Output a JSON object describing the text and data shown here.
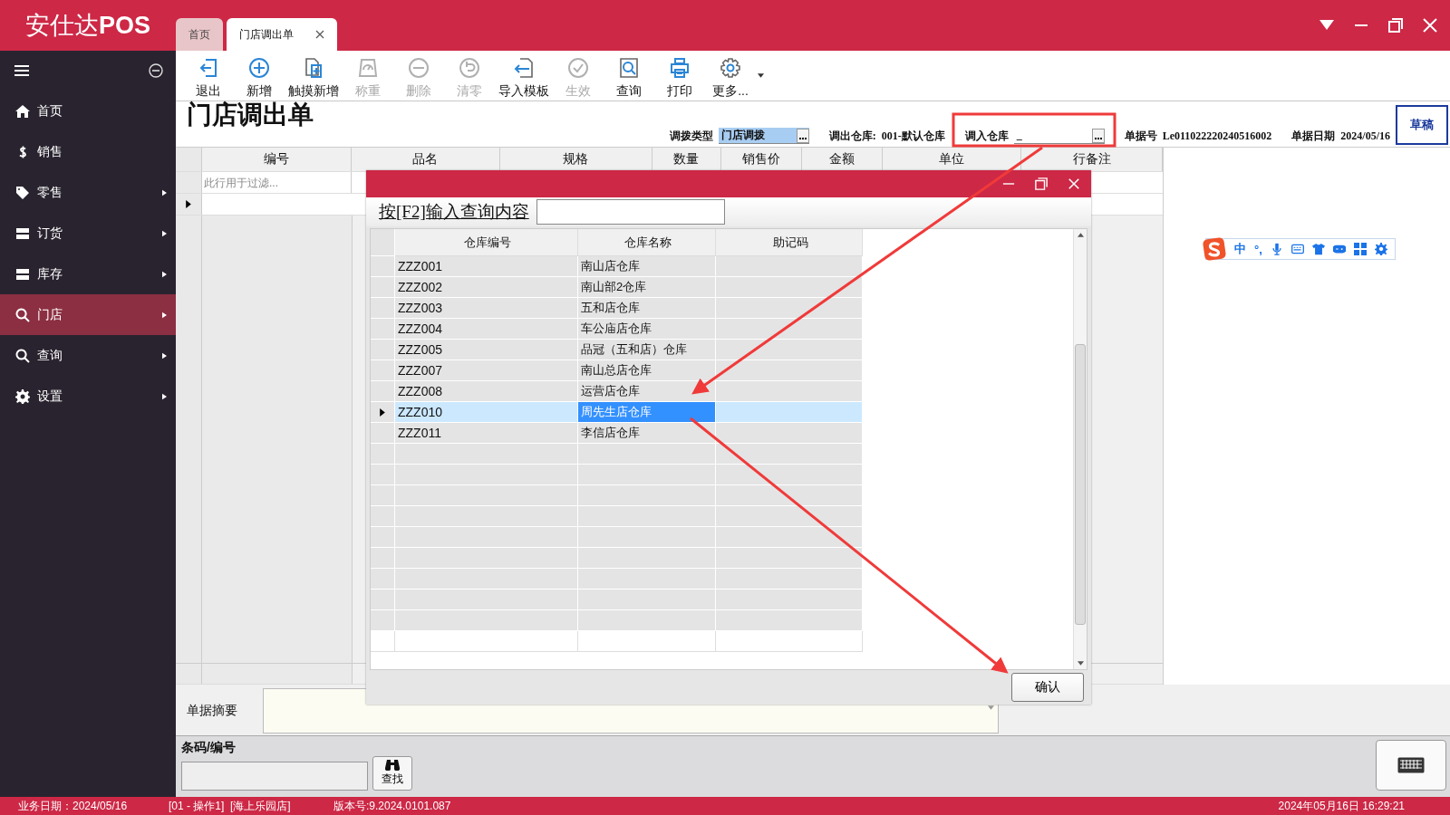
{
  "logo": "安仕达**POS**",
  "tabs": [
    {
      "label": "首页",
      "selected": false,
      "closable": false
    },
    {
      "label": "门店调出单",
      "selected": true,
      "closable": true
    }
  ],
  "sidebar": {
    "items": [
      {
        "label": "首页",
        "submenu": false,
        "selected": false
      },
      {
        "label": "销售",
        "submenu": false,
        "selected": false
      },
      {
        "label": "零售",
        "submenu": true,
        "selected": false
      },
      {
        "label": "订货",
        "submenu": true,
        "selected": false
      },
      {
        "label": "库存",
        "submenu": true,
        "selected": false
      },
      {
        "label": "门店",
        "submenu": true,
        "selected": true
      },
      {
        "label": "查询",
        "submenu": true,
        "selected": false
      },
      {
        "label": "设置",
        "submenu": true,
        "selected": false
      }
    ]
  },
  "toolbar": [
    {
      "label": "退出",
      "disabled": false
    },
    {
      "label": "新增",
      "disabled": false
    },
    {
      "label": "触摸新增",
      "disabled": false
    },
    {
      "label": "称重",
      "disabled": true
    },
    {
      "label": "删除",
      "disabled": true
    },
    {
      "label": "清零",
      "disabled": true
    },
    {
      "label": "导入模板",
      "disabled": false
    },
    {
      "label": "生效",
      "disabled": true
    },
    {
      "label": "查询",
      "disabled": false
    },
    {
      "label": "打印",
      "disabled": false
    },
    {
      "label": "更多...",
      "disabled": false
    }
  ],
  "page_title": "门店调出单",
  "fields": [
    {
      "label": "调拨类型",
      "value": "门店调拨",
      "kind": "picker"
    },
    {
      "label": "调出仓库:",
      "value": "001-默认仓库",
      "kind": "text"
    },
    {
      "label": "调入仓库",
      "value": "_",
      "kind": "picker"
    },
    {
      "label": "单据号",
      "value": "Le011022220240516002",
      "kind": "text"
    },
    {
      "label": "单据日期",
      "value": "2024/05/16",
      "kind": "text"
    }
  ],
  "status_button": "草稿",
  "grid": {
    "columns": [
      "编号",
      "品名",
      "规格",
      "数量",
      "销售价",
      "金额",
      "单位",
      "行备注"
    ],
    "filter_placeholder": "此行用于过滤..."
  },
  "dialog": {
    "search_label": "按[F2]输入查询内容",
    "columns": [
      "仓库编号",
      "仓库名称",
      "助记码"
    ],
    "rows": [
      {
        "code": "ZZZ001",
        "name": "南山店仓库",
        "selected": false
      },
      {
        "code": "ZZZ002",
        "name": "南山部2仓库",
        "selected": false
      },
      {
        "code": "ZZZ003",
        "name": "五和店仓库",
        "selected": false
      },
      {
        "code": "ZZZ004",
        "name": "车公庙店仓库",
        "selected": false
      },
      {
        "code": "ZZZ005",
        "name": "品冠（五和店）仓库",
        "selected": false
      },
      {
        "code": "ZZZ007",
        "name": "南山总店仓库",
        "selected": false
      },
      {
        "code": "ZZZ008",
        "name": "运营店仓库",
        "selected": false
      },
      {
        "code": "ZZZ010",
        "name": "周先生店仓库",
        "selected": true
      },
      {
        "code": "ZZZ011",
        "name": "李信店仓库",
        "selected": false
      }
    ],
    "confirm": "确认"
  },
  "ime": {
    "mode": "中",
    "punct": "°,"
  },
  "summary_label": "单据摘要",
  "barcode_label": "条码/编号",
  "find_button": "查找",
  "status_bar": {
    "business_date": "业务日期：2024/05/16",
    "operator": "[01 - 操作1]  [海上乐园店]",
    "version": "版本号:9.2024.0101.087",
    "clock": "2024年05月16日 16:29:21"
  }
}
